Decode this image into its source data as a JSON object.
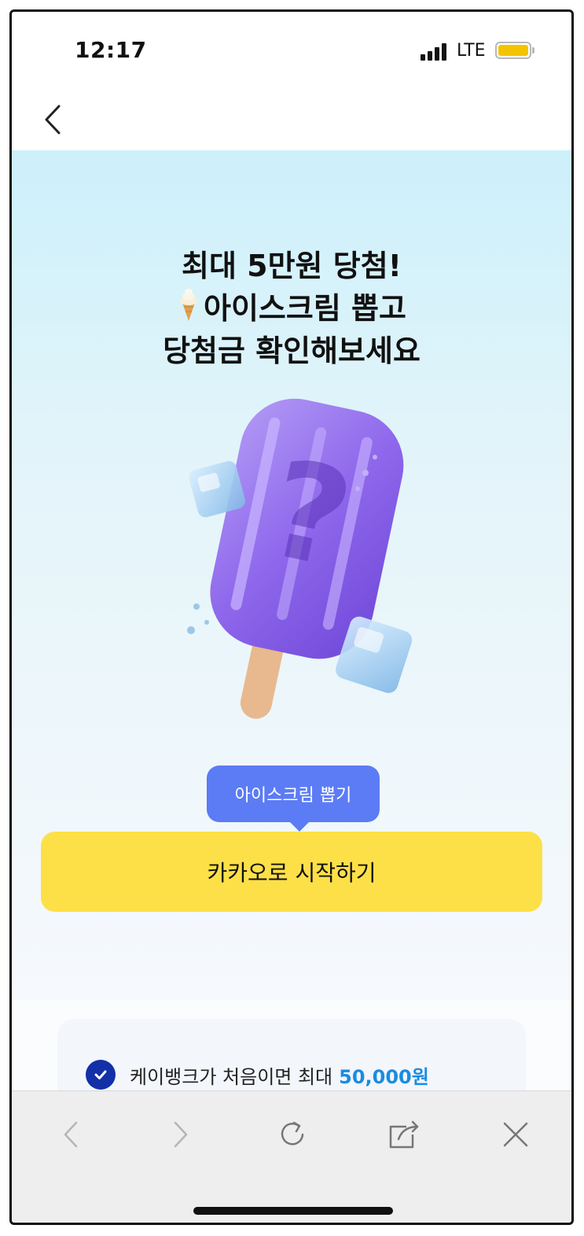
{
  "status_bar": {
    "time": "12:17",
    "network": "LTE",
    "battery_color": "#f5c400"
  },
  "nav": {
    "back_icon": "chevron-left-icon"
  },
  "hero": {
    "headline_line1": "최대 5만원 당첨!",
    "headline_line2": "아이스크림 뽑고",
    "headline_line3": "당첨금 확인해보세요",
    "headline_emoji": "soft-serve-cone-icon",
    "illustration": "purple-popsicle-with-question-mark",
    "tooltip_label": "아이스크림 뽑기",
    "tooltip_color": "#5b7cf5",
    "start_button_label": "카카오로 시작하기",
    "start_button_color": "#fde047"
  },
  "benefits": {
    "items": [
      {
        "text": "케이뱅크가 처음이면 최대",
        "amount": "50,000원",
        "checked": true
      }
    ],
    "amount_color": "#1a8ce0"
  },
  "browser_toolbar": {
    "buttons": [
      "back-icon",
      "forward-icon",
      "reload-icon",
      "share-icon",
      "close-icon"
    ]
  }
}
